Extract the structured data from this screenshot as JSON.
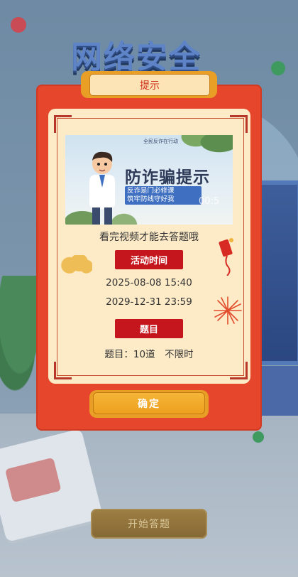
{
  "background": {
    "title": "网络安全",
    "start_button": "开始答题"
  },
  "modal": {
    "title": "提示",
    "video": {
      "top_text": "全民反诈在行动",
      "headline": "防诈骗提示",
      "subtitle_line1": "反诈是门必修课",
      "subtitle_line2": "筑牢防线守好我",
      "time_overlay": "00:5"
    },
    "watch_note": "看完视频才能去答题哦",
    "activity_time_label": "活动时间",
    "start_time": "2025-08-08 15:40",
    "end_time": "2029-12-31 23:59",
    "topic_label": "题目",
    "topic_info": "题目：10道　不限时",
    "confirm_label": "确定"
  },
  "colors": {
    "modal_red": "#e5462c",
    "paper": "#fdebc8",
    "label_red": "#c4161c",
    "gold": "#ee9f1f"
  }
}
